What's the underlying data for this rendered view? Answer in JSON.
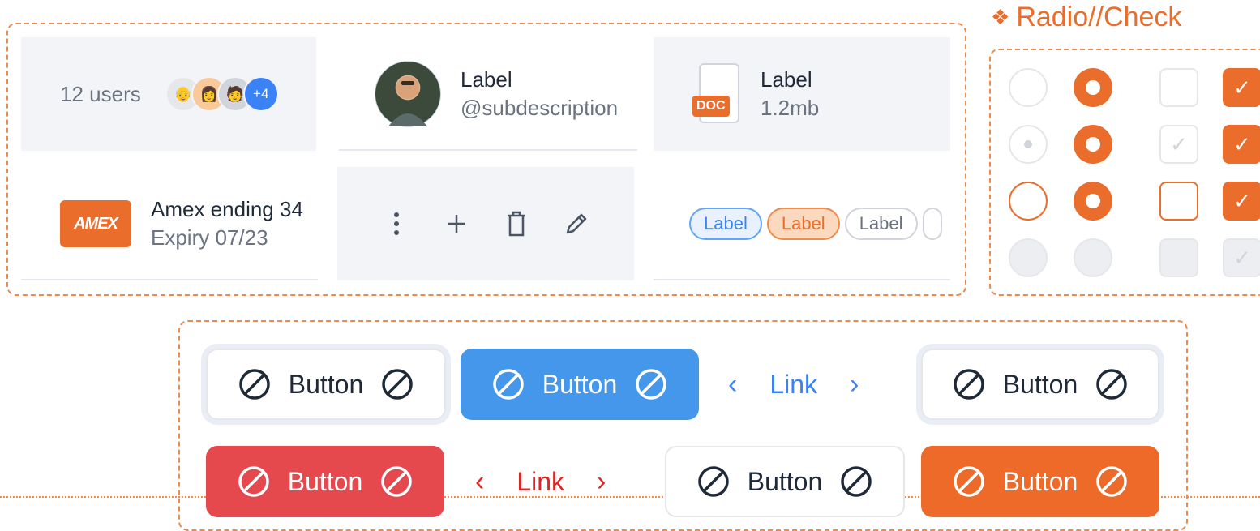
{
  "section_title": "Radio//Check",
  "users_cell": {
    "text": "12 users",
    "extra_count": "+4"
  },
  "profile_cell": {
    "label": "Label",
    "subdescription": "@subdescription"
  },
  "file_cell": {
    "badge": "DOC",
    "label": "Label",
    "size": "1.2mb"
  },
  "card_cell": {
    "logo": "AMEX",
    "label": "Amex ending 34",
    "expiry": "Expiry 07/23"
  },
  "actions": [
    "more-vertical-icon",
    "plus-icon",
    "trash-icon",
    "pencil-icon"
  ],
  "tags": [
    "Label",
    "Label",
    "Label"
  ],
  "radio_check_grid": {
    "rows": [
      [
        "radio-empty",
        "radio-checked",
        "checkbox-empty",
        "checkbox-checked"
      ],
      [
        "radio-hover",
        "radio-checked",
        "checkbox-hover",
        "checkbox-checked"
      ],
      [
        "radio-focus",
        "radio-checked",
        "checkbox-focus",
        "checkbox-checked"
      ],
      [
        "radio-disabled",
        "radio-disabled",
        "checkbox-disabled",
        "checkbox-disabled-checked"
      ]
    ]
  },
  "buttons": {
    "button_label": "Button",
    "link_label": "Link"
  },
  "colors": {
    "accent_orange": "#ea6d2b",
    "primary_blue": "#4597ec",
    "danger_red": "#e5484d"
  }
}
